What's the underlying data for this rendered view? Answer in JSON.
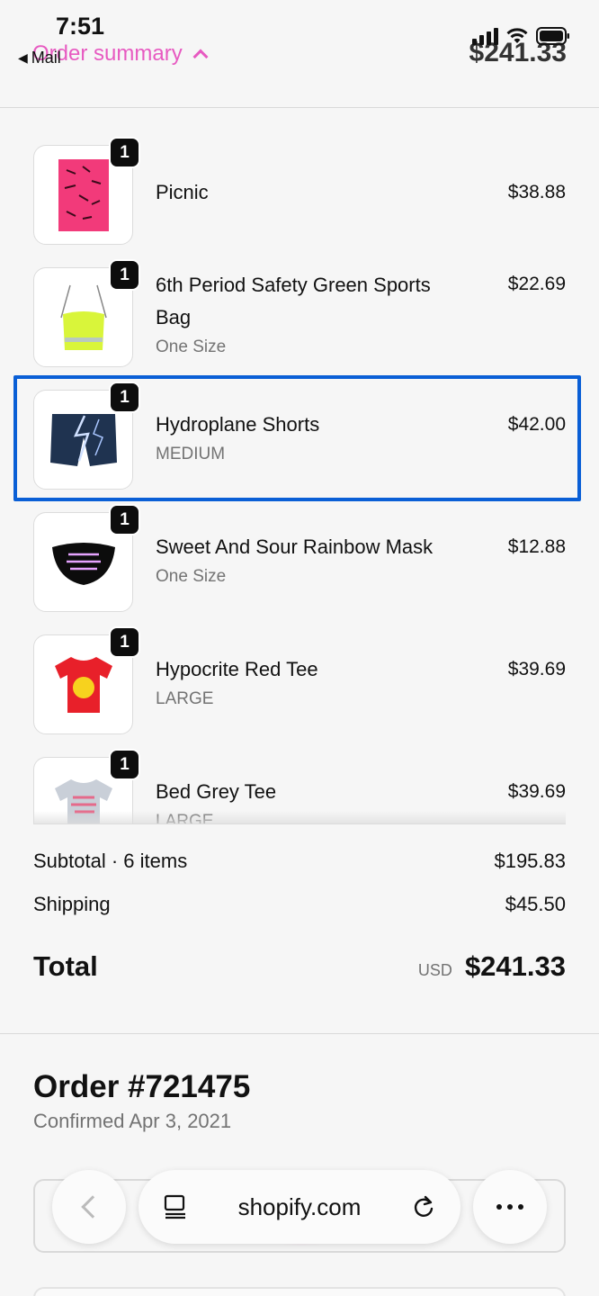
{
  "status_bar": {
    "time": "7:51",
    "back_app": "Mail"
  },
  "header": {
    "order_summary_label": "Order summary",
    "total": "$241.33"
  },
  "products": [
    {
      "name": "Picnic",
      "variant": "",
      "price": "$38.88",
      "qty": "1",
      "thumb": "pink-towel"
    },
    {
      "name": "6th Period Safety Green Sports Bag",
      "variant": "One Size",
      "price": "$22.69",
      "qty": "1",
      "thumb": "green-drawstring-bag"
    },
    {
      "name": "Hydroplane Shorts",
      "variant": "MEDIUM",
      "price": "$42.00",
      "qty": "1",
      "thumb": "lightning-shorts"
    },
    {
      "name": "Sweet And Sour Rainbow Mask",
      "variant": "One Size",
      "price": "$12.88",
      "qty": "1",
      "thumb": "black-mask"
    },
    {
      "name": "Hypocrite Red Tee",
      "variant": "LARGE",
      "price": "$39.69",
      "qty": "1",
      "thumb": "red-tee"
    },
    {
      "name": "Bed Grey Tee",
      "variant": "LARGE",
      "price": "$39.69",
      "qty": "1",
      "thumb": "grey-tee"
    }
  ],
  "totals": {
    "subtotal_label": "Subtotal · 6 items",
    "subtotal_value": "$195.83",
    "shipping_label": "Shipping",
    "shipping_value": "$45.50",
    "total_label": "Total",
    "currency": "USD",
    "total_value": "$241.33"
  },
  "order": {
    "number": "Order #721475",
    "confirmed": "Confirmed Apr 3, 2021"
  },
  "browser": {
    "url": "shopify.com"
  },
  "colors": {
    "accent_pink": "#e53fb8",
    "highlight_blue": "#0a5fd6",
    "badge_black": "#0d0d0d"
  }
}
